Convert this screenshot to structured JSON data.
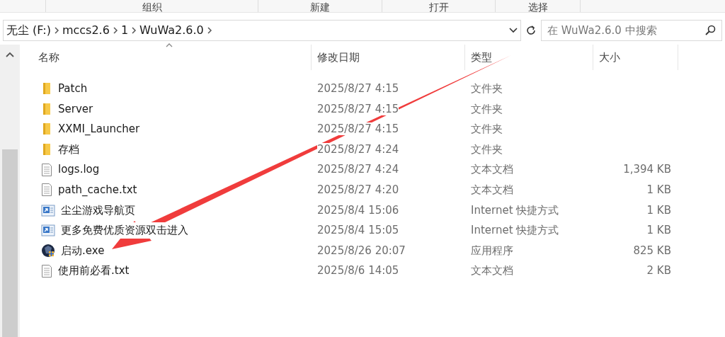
{
  "ribbon_groups": [
    "组织",
    "新建",
    "打开",
    "选择"
  ],
  "address_bar": {
    "path": [
      "无尘 (F:)",
      "mccs2.6",
      "1",
      "WuWa2.6.0"
    ]
  },
  "search": {
    "placeholder": "在 WuWa2.6.0 中搜索"
  },
  "columns": [
    "名称",
    "修改日期",
    "类型",
    "大小"
  ],
  "rows": [
    {
      "kind": "folder",
      "name": "Patch",
      "date": "2025/8/27 4:15",
      "type": "文件夹",
      "size": ""
    },
    {
      "kind": "folder",
      "name": "Server",
      "date": "2025/8/27 4:15",
      "type": "文件夹",
      "size": ""
    },
    {
      "kind": "folder",
      "name": "XXMI_Launcher",
      "date": "2025/8/27 4:15",
      "type": "文件夹",
      "size": ""
    },
    {
      "kind": "folder",
      "name": "存档",
      "date": "2025/8/27 4:24",
      "type": "文件夹",
      "size": ""
    },
    {
      "kind": "text",
      "name": "logs.log",
      "date": "2025/8/27 4:24",
      "type": "文本文档",
      "size": "1,394 KB"
    },
    {
      "kind": "text",
      "name": "path_cache.txt",
      "date": "2025/8/27 4:20",
      "type": "文本文档",
      "size": "1 KB"
    },
    {
      "kind": "shortcut",
      "name": "尘尘游戏导航页",
      "date": "2025/8/4 15:06",
      "type": "Internet 快捷方式",
      "size": "1 KB"
    },
    {
      "kind": "shortcut",
      "name": "更多免费优质资源双击进入",
      "date": "2025/8/4 15:05",
      "type": "Internet 快捷方式",
      "size": "1 KB"
    },
    {
      "kind": "app",
      "name": "启动.exe",
      "date": "2025/8/26 20:07",
      "type": "应用程序",
      "size": "825 KB"
    },
    {
      "kind": "text",
      "name": "使用前必看.txt",
      "date": "2025/8/6 14:05",
      "type": "文本文档",
      "size": "2 KB"
    }
  ]
}
